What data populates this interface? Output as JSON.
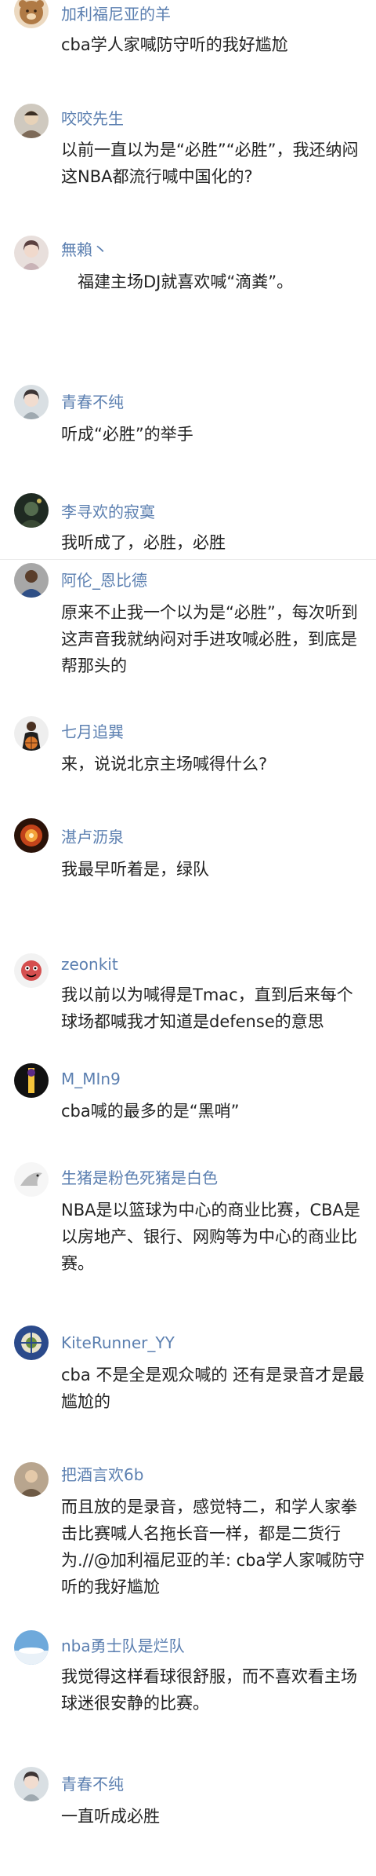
{
  "comments": [
    {
      "username": "加利福尼亚的羊",
      "text": "cba学人家喊防守听的我好尴尬",
      "avatar": "bear-avatar"
    },
    {
      "username": "咬咬先生",
      "text": "以前一直以为是“必胜”“必胜”，我还纳闷这NBA都流行喊中国化的?",
      "avatar": "person-avatar"
    },
    {
      "username": "無賴丶",
      "text": "　福建主场DJ就喜欢喊“滴粪”。",
      "avatar": "girl-avatar"
    },
    {
      "username": "青春不纯",
      "text": "听成“必胜”的举手",
      "avatar": "girl-avatar"
    },
    {
      "username": "李寻欢的寂寞",
      "text": "我听成了，必胜，必胜",
      "avatar": "dark-avatar"
    },
    {
      "username": "阿伦_恩比德",
      "text": "原来不止我一个以为是“必胜”，每次听到这声音我就纳闷对手进攻喊必胜，到底是帮那头的",
      "avatar": "player-avatar"
    },
    {
      "username": "七月追巽",
      "text": "来，说说北京主场喊得什么?",
      "avatar": "basketball-avatar"
    },
    {
      "username": "湛卢沥泉",
      "text": "我最早听着是，绿队",
      "avatar": "fire-avatar"
    },
    {
      "username": "zeonkit",
      "text": "我以前以为喊得是Tmac，直到后来每个球场都喊我才知道是defense的意思",
      "avatar": "cartoon-avatar"
    },
    {
      "username": "M_MIn9",
      "text": "cba喊的最多的是“黑哨”",
      "avatar": "lakers-avatar"
    },
    {
      "username": "生猪是粉色死猪是白色",
      "text": "NBA是以篮球为中心的商业比赛，CBA是以房地产、银行、网购等为中心的商业比赛。",
      "avatar": "bird-avatar"
    },
    {
      "username": "KiteRunner_YY",
      "text": "cba 不是全是观众喊的 还有是录音才是最尴尬的",
      "avatar": "badge-avatar"
    },
    {
      "username": "把酒言欢6b",
      "text": "而且放的是录音，感觉特二，和学人家拳击比赛喊人名拖长音一样，都是二货行为.//@加利福尼亚的羊: cba学人家喊防守听的我好尴尬",
      "avatar": "person-avatar"
    },
    {
      "username": "nba勇士队是烂队",
      "text": "我觉得这样看球很舒服，而不喜欢看主场球迷很安静的比赛。",
      "avatar": "sky-avatar"
    },
    {
      "username": "青春不纯",
      "text": "一直听成必胜",
      "avatar": "girl-avatar"
    }
  ]
}
